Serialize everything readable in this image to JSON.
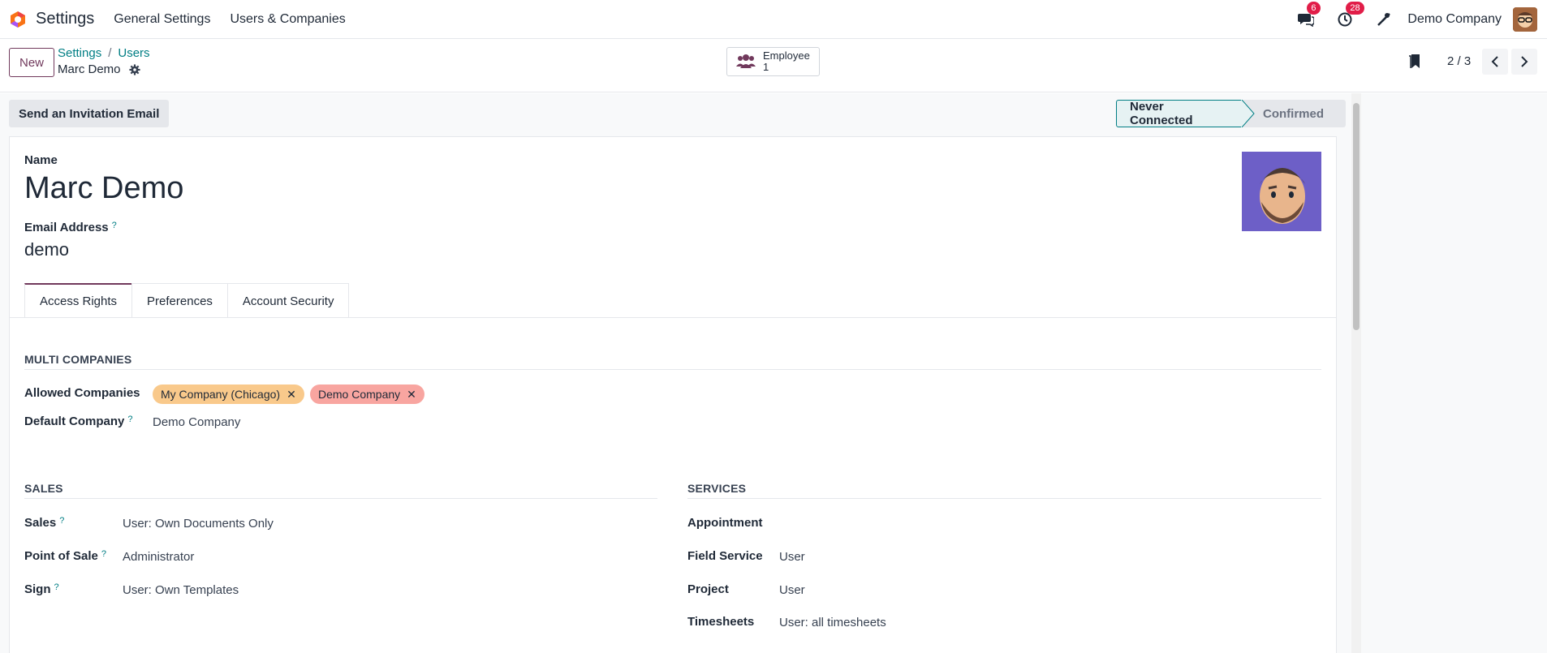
{
  "topnav": {
    "app_title": "Settings",
    "menu": [
      "General Settings",
      "Users & Companies"
    ],
    "messages_count": "6",
    "activities_count": "28",
    "company": "Demo Company"
  },
  "control_panel": {
    "new_label": "New",
    "breadcrumb": [
      "Settings",
      "Users"
    ],
    "record_title": "Marc Demo",
    "smart_button": {
      "label": "Employee",
      "count": "1"
    },
    "pager": "2 / 3"
  },
  "statusbar": {
    "invite_label": "Send an Invitation Email",
    "stages": [
      "Never Connected",
      "Confirmed"
    ],
    "active_stage": "Never Connected"
  },
  "form": {
    "name_label": "Name",
    "name_value": "Marc Demo",
    "email_label": "Email Address",
    "email_value": "demo",
    "help_mark": "?",
    "tabs": [
      "Access Rights",
      "Preferences",
      "Account Security"
    ],
    "active_tab": "Access Rights"
  },
  "multi_companies": {
    "title": "MULTI COMPANIES",
    "allowed_label": "Allowed Companies",
    "allowed": [
      {
        "name": "My Company (Chicago)",
        "color": "#f9c98b"
      },
      {
        "name": "Demo Company",
        "color": "#f8a5a0"
      }
    ],
    "default_label": "Default Company",
    "default_value": "Demo Company"
  },
  "sales": {
    "title": "SALES",
    "rows": [
      {
        "label": "Sales",
        "value": "User: Own Documents Only"
      },
      {
        "label": "Point of Sale",
        "value": "Administrator"
      },
      {
        "label": "Sign",
        "value": "User: Own Templates"
      }
    ]
  },
  "services": {
    "title": "SERVICES",
    "rows": [
      {
        "label": "Appointment",
        "value": ""
      },
      {
        "label": "Field Service",
        "value": "User"
      },
      {
        "label": "Project",
        "value": "User"
      },
      {
        "label": "Timesheets",
        "value": "User: all timesheets"
      }
    ]
  },
  "colors": {
    "brand": "#71395c",
    "accent": "#017e84",
    "badge": "#e11d48"
  }
}
